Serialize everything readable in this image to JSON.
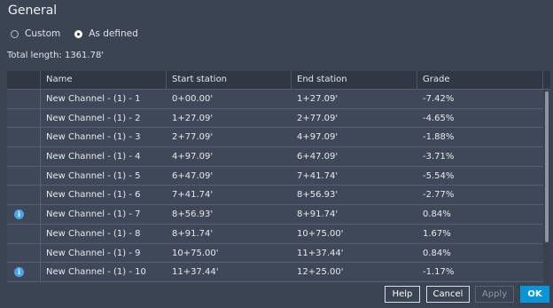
{
  "title": "General",
  "options": {
    "custom": "Custom",
    "as_defined": "As defined",
    "selected": "As defined"
  },
  "total_length": "Total length: 1361.78'",
  "table": {
    "columns": [
      "",
      "Name",
      "Start station",
      "End station",
      "Grade"
    ],
    "rows": [
      {
        "info": false,
        "name": "New Channel - (1) - 1",
        "start": "0+00.00'",
        "end": "1+27.09'",
        "grade": "-7.42%"
      },
      {
        "info": false,
        "name": "New Channel - (1) - 2",
        "start": "1+27.09'",
        "end": "2+77.09'",
        "grade": "-4.65%"
      },
      {
        "info": false,
        "name": "New Channel - (1) - 3",
        "start": "2+77.09'",
        "end": "4+97.09'",
        "grade": "-1.88%"
      },
      {
        "info": false,
        "name": "New Channel - (1) - 4",
        "start": "4+97.09'",
        "end": "6+47.09'",
        "grade": "-3.71%"
      },
      {
        "info": false,
        "name": "New Channel - (1) - 5",
        "start": "6+47.09'",
        "end": "7+41.74'",
        "grade": "-5.54%"
      },
      {
        "info": false,
        "name": "New Channel - (1) - 6",
        "start": "7+41.74'",
        "end": "8+56.93'",
        "grade": "-2.77%"
      },
      {
        "info": true,
        "name": "New Channel - (1) - 7",
        "start": "8+56.93'",
        "end": "8+91.74'",
        "grade": "0.84%"
      },
      {
        "info": false,
        "name": "New Channel - (1) - 8",
        "start": "8+91.74'",
        "end": "10+75.00'",
        "grade": "1.67%"
      },
      {
        "info": false,
        "name": "New Channel - (1) - 9",
        "start": "10+75.00'",
        "end": "11+37.44'",
        "grade": "0.84%"
      },
      {
        "info": true,
        "name": "New Channel - (1) - 10",
        "start": "11+37.44'",
        "end": "12+25.00'",
        "grade": "-1.17%"
      }
    ]
  },
  "buttons": {
    "help": "Help",
    "cancel": "Cancel",
    "apply": "Apply",
    "ok": "OK"
  },
  "icons": {
    "info": "info-icon"
  },
  "colors": {
    "background": "#3b4453",
    "accent": "#0696d7",
    "info": "#4aa3e8"
  }
}
